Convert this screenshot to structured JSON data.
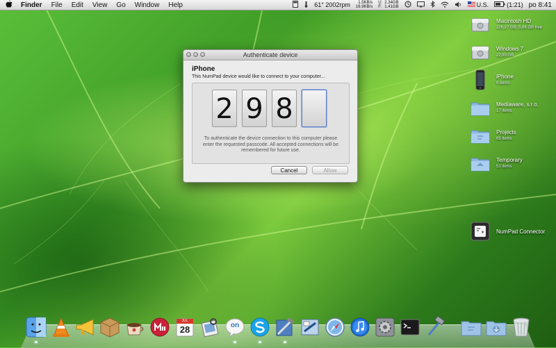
{
  "menubar": {
    "apple": "",
    "items": [
      "Finder",
      "File",
      "Edit",
      "View",
      "Go",
      "Window",
      "Help"
    ],
    "temp": "61° 2002rpm",
    "net_up": "1.5KB/s",
    "net_down": "16.9KB/s",
    "mem_u_label": "U:",
    "mem_f_label": "F:",
    "mem_used": "2.34GB",
    "mem_free": "1.41GB",
    "input_source": "U.S.",
    "battery": "(1:21)",
    "clock": "po 8:41"
  },
  "dialog": {
    "title": "Authenticate device",
    "device": "iPhone",
    "subtitle": "This NumPad device would like to connect to your computer...",
    "digits": [
      "2",
      "9",
      "8",
      ""
    ],
    "info": "To authenticate the device connection to this computer please enter the requested passcode. All accepted connections will be remembered for future use.",
    "cancel": "Cancel",
    "allow": "Allow"
  },
  "desktop": [
    {
      "label": "Macintosh HD",
      "sub": "226,27 GB, 5,86 GB free",
      "icon": "hard-drive-icon"
    },
    {
      "label": "Windows 7",
      "sub": "22,93 GB",
      "icon": "hard-drive-icon"
    },
    {
      "label": "iPhone",
      "sub": "6 items",
      "icon": "iphone-icon"
    },
    {
      "label": "Mediaware, s.r.o.",
      "sub": "17 items",
      "icon": "folder-icon"
    },
    {
      "label": "Projects",
      "sub": "65 items",
      "icon": "folder-icon"
    },
    {
      "label": "Temporary",
      "sub": "51 items",
      "icon": "folder-icon"
    },
    {
      "label": "NumPad Connector",
      "sub": "",
      "icon": "numpad-app-icon"
    }
  ],
  "dock": {
    "calendar_month": "JUL",
    "calendar_day": "28",
    "on_label": "on",
    "icons": [
      "finder-icon",
      "vlc-icon",
      "megaphone-icon",
      "package-icon",
      "coffee-icon",
      "miro-icon",
      "calendar-icon",
      "preview-icon",
      "on-icon",
      "skype-icon",
      "xcode-icon",
      "mail-icon",
      "safari-icon",
      "itunes-icon",
      "system-preferences-icon",
      "terminal-icon",
      "xcode-hammer-icon",
      "applications-folder-icon",
      "downloads-folder-icon",
      "trash-icon"
    ]
  },
  "colors": {
    "dialog_bg": "#ececec",
    "accent": "#5f7fbf",
    "wallpaper": "#3e9b26"
  }
}
